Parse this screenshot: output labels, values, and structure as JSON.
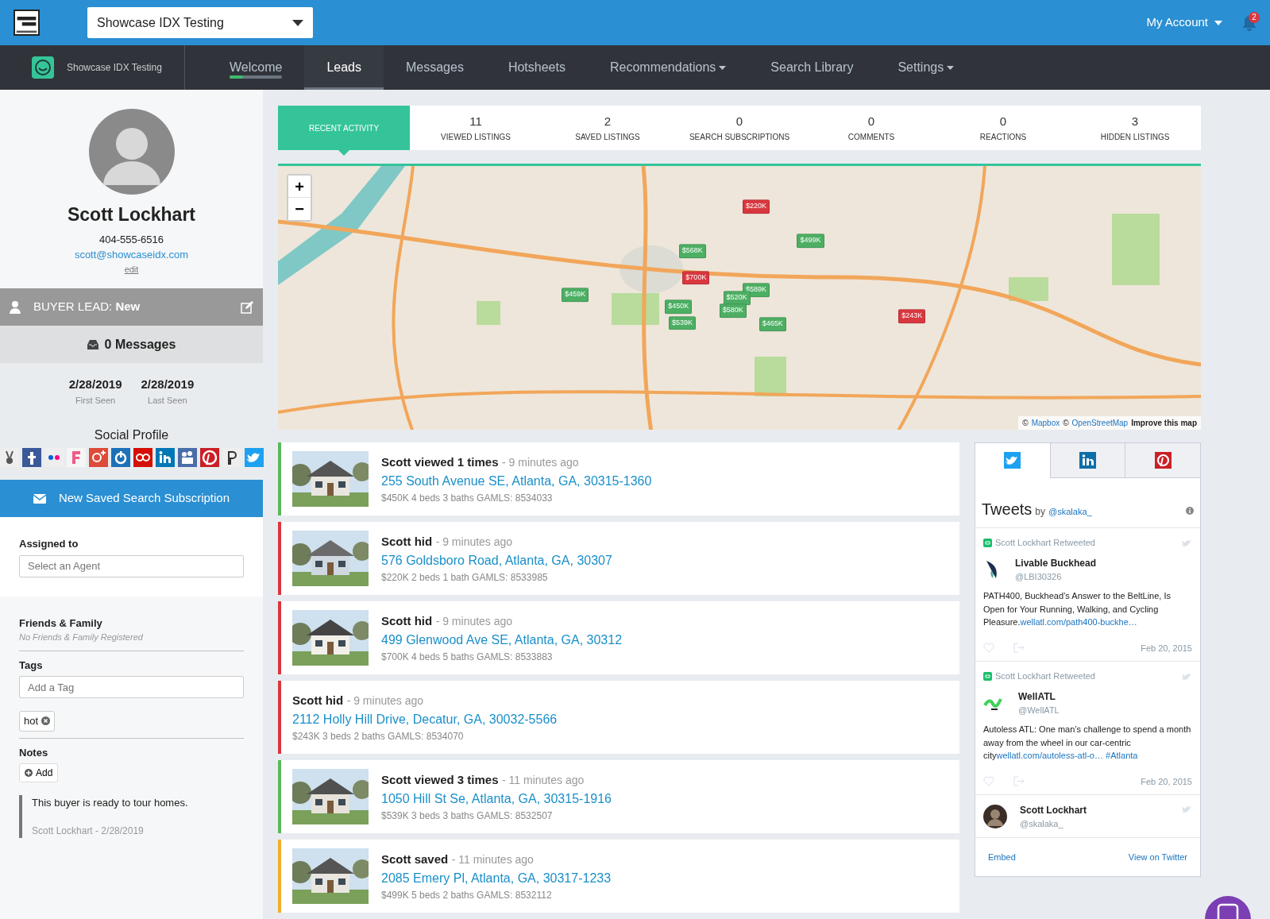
{
  "top_bar": {
    "site_select": "Showcase IDX Testing",
    "account": "My Account",
    "notifications": "2"
  },
  "nav": {
    "brand": "Showcase IDX Testing",
    "items": [
      {
        "label": "Welcome",
        "selected": false,
        "dropdown": false,
        "level": 0.25
      },
      {
        "label": "Leads",
        "selected": true,
        "dropdown": false
      },
      {
        "label": "Messages",
        "selected": false,
        "dropdown": false
      },
      {
        "label": "Hotsheets",
        "selected": false,
        "dropdown": false
      },
      {
        "label": "Recommendations",
        "selected": false,
        "dropdown": true
      },
      {
        "label": "Search Library",
        "selected": false,
        "dropdown": false
      },
      {
        "label": "Settings",
        "selected": false,
        "dropdown": true
      }
    ]
  },
  "profile": {
    "name": "Scott Lockhart",
    "phone": "404-555-6516",
    "email": "scott@showcaseidx.com",
    "edit": "edit"
  },
  "lead_status": {
    "label": "BUYER LEAD:",
    "value": "New"
  },
  "messages": "0 Messages",
  "dates": [
    {
      "value": "2/28/2019",
      "label": "First Seen"
    },
    {
      "value": "2/28/2019",
      "label": "Last Seen"
    }
  ],
  "social_title": "Social Profile",
  "subscription_button": "New Saved Search Subscription",
  "assigned": {
    "label": "Assigned to",
    "placeholder": "Select an Agent"
  },
  "friends": {
    "title": "Friends & Family",
    "empty": "No Friends & Family Registered"
  },
  "tags": {
    "label": "Tags",
    "placeholder": "Add a Tag",
    "items": [
      "hot"
    ]
  },
  "notes": {
    "title": "Notes",
    "add_button": "Add",
    "items": [
      {
        "text": "This buyer is ready to tour homes.",
        "meta": "Scott Lockhart - 2/28/2019"
      }
    ]
  },
  "activity_tabs": [
    {
      "label": "RECENT ACTIVITY",
      "selected": true
    },
    {
      "count": "11",
      "label": "VIEWED LISTINGS",
      "selected": false
    },
    {
      "count": "2",
      "label": "SAVED LISTINGS",
      "selected": false
    },
    {
      "count": "0",
      "label": "SEARCH SUBSCRIPTIONS",
      "selected": false
    },
    {
      "count": "0",
      "label": "COMMENTS",
      "selected": false
    },
    {
      "count": "0",
      "label": "REACTIONS",
      "selected": false
    },
    {
      "count": "3",
      "label": "HIDDEN LISTINGS",
      "selected": false
    }
  ],
  "map": {
    "zoom_in": "+",
    "zoom_out": "−",
    "pins": [
      {
        "price": "$220K",
        "color": "#d9373f"
      },
      {
        "price": "$568K",
        "color": "#4caf63"
      },
      {
        "price": "$499K",
        "color": "#4caf63"
      },
      {
        "price": "$700K",
        "color": "#d9373f"
      },
      {
        "price": "$459K",
        "color": "#4caf63"
      },
      {
        "price": "$589K",
        "color": "#4caf63"
      },
      {
        "price": "$520K",
        "color": "#4caf63"
      },
      {
        "price": "$450K",
        "color": "#4caf63"
      },
      {
        "price": "$580K",
        "color": "#4caf63"
      },
      {
        "price": "$539K",
        "color": "#4caf63"
      },
      {
        "price": "$465K",
        "color": "#4caf63"
      },
      {
        "price": "$243K",
        "color": "#d9373f"
      }
    ],
    "attribution": [
      {
        "text": "©",
        "kind": "plain"
      },
      {
        "text": "Mapbox",
        "kind": "link"
      },
      {
        "text": "©",
        "kind": "plain"
      },
      {
        "text": "OpenStreetMap",
        "kind": "link"
      },
      {
        "text": "Improve this map",
        "kind": "strong"
      }
    ]
  },
  "activity": [
    {
      "title": "Scott viewed 1 times",
      "time": "- 9 minutes ago",
      "address": "255 South Avenue SE, Atlanta, GA, 30315-1360",
      "details": "$450K 4 beds 3 baths GAMLS: 8534033",
      "color": "#5cb85c",
      "photo": true
    },
    {
      "title": "Scott hid",
      "time": "- 9 minutes ago",
      "address": "576 Goldsboro Road, Atlanta, GA, 30307",
      "details": "$220K 2 beds 1 bath GAMLS: 8533985",
      "color": "#d9373f",
      "photo": true
    },
    {
      "title": "Scott hid",
      "time": "- 9 minutes ago",
      "address": "499 Glenwood Ave SE, Atlanta, GA, 30312",
      "details": "$700K 4 beds 5 baths GAMLS: 8533883",
      "color": "#d9373f",
      "photo": true
    },
    {
      "title": "Scott hid",
      "time": "- 9 minutes ago",
      "address": "2112 Holly Hill Drive, Decatur, GA, 30032-5566",
      "details": "$243K 3 beds 2 baths GAMLS: 8534070",
      "color": "#d9373f",
      "photo": false
    },
    {
      "title": "Scott viewed 3 times",
      "time": "- 11 minutes ago",
      "address": "1050 Hill St Se, Atlanta, GA, 30315-1916",
      "details": "$539K 3 beds 3 baths GAMLS: 8532507",
      "color": "#5cb85c",
      "photo": true
    },
    {
      "title": "Scott saved",
      "time": "- 11 minutes ago",
      "address": "2085 Emery Pl, Atlanta, GA, 30317-1233",
      "details": "$499K 5 beds 2 baths GAMLS: 8532112",
      "color": "#f0ad2e",
      "photo": true
    }
  ],
  "social_tabs": [
    {
      "kind": "twitter",
      "selected": true
    },
    {
      "kind": "linkedin",
      "selected": false
    },
    {
      "kind": "pinterest",
      "selected": false
    }
  ],
  "tweets_header": {
    "title": "Tweets",
    "by": "by",
    "handle": "@skalaka_"
  },
  "tweets": [
    {
      "retweet_label": "Scott Lockhart Retweeted",
      "name": "Livable Buckhead",
      "handle": "@LBI30326",
      "text": "PATH400, Buckhead’s Answer to the BeltLine, Is Open for Your Running, Walking, and Cycling Pleasure.",
      "links": [
        "wellatl.com/path400-buckhe…"
      ],
      "date": "Feb 20, 2015",
      "kind": "bird"
    },
    {
      "retweet_label": "Scott Lockhart Retweeted",
      "name": "WellATL",
      "handle": "@WellATL",
      "text": "Autoless ATL: One man’s challenge to spend a month away from the wheel in our car-centric city",
      "links": [
        "wellatl.com/autoless-atl-o…",
        "#Atlanta"
      ],
      "date": "Feb 20, 2015",
      "kind": "script"
    }
  ],
  "twitter_profile": {
    "name": "Scott Lockhart",
    "handle": "@skalaka_"
  },
  "twitter_footer": [
    "Embed",
    "View on Twitter"
  ]
}
